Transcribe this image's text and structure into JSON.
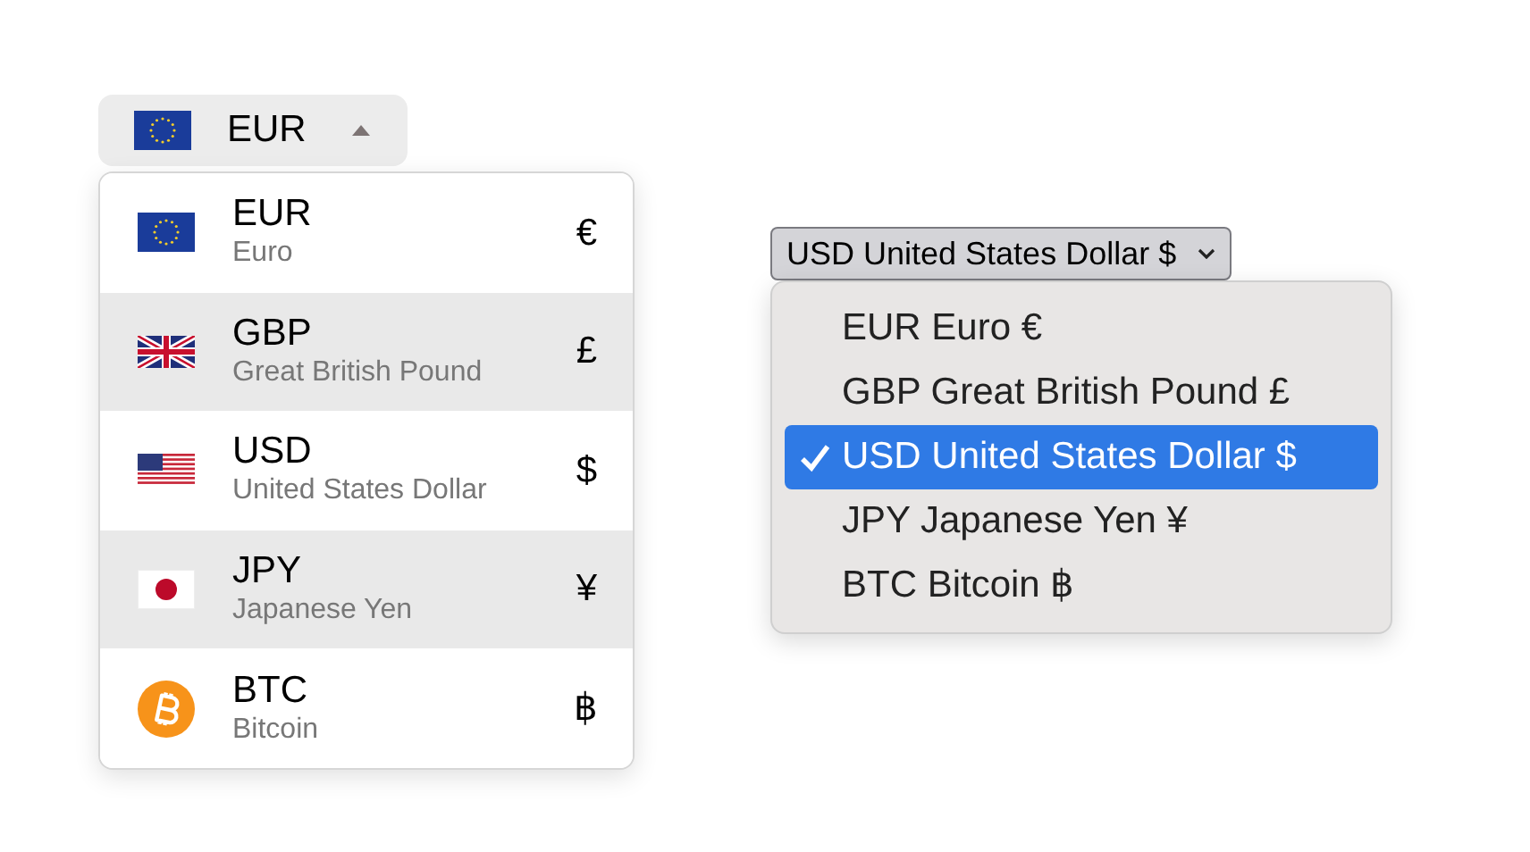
{
  "custom_select": {
    "value": {
      "code": "EUR",
      "kind": "eu"
    },
    "expanded": true,
    "options": [
      {
        "code": "EUR",
        "name": "Euro",
        "symbol": "€",
        "kind": "eu",
        "highlighted": false
      },
      {
        "code": "GBP",
        "name": "Great British Pound",
        "symbol": "£",
        "kind": "gb",
        "highlighted": true
      },
      {
        "code": "USD",
        "name": "United States Dollar",
        "symbol": "$",
        "kind": "us",
        "highlighted": false
      },
      {
        "code": "JPY",
        "name": "Japanese Yen",
        "symbol": "¥",
        "kind": "jp",
        "highlighted": true
      },
      {
        "code": "BTC",
        "name": "Bitcoin",
        "symbol": "฿",
        "kind": "btc",
        "highlighted": false
      }
    ]
  },
  "native_select": {
    "value": "USD United States Dollar $",
    "options": [
      {
        "label": "EUR Euro €",
        "selected": false
      },
      {
        "label": "GBP Great British Pound £",
        "selected": false
      },
      {
        "label": "USD United States Dollar $",
        "selected": true
      },
      {
        "label": "JPY Japanese Yen ¥",
        "selected": false
      },
      {
        "label": "BTC Bitcoin ฿",
        "selected": false
      }
    ]
  }
}
